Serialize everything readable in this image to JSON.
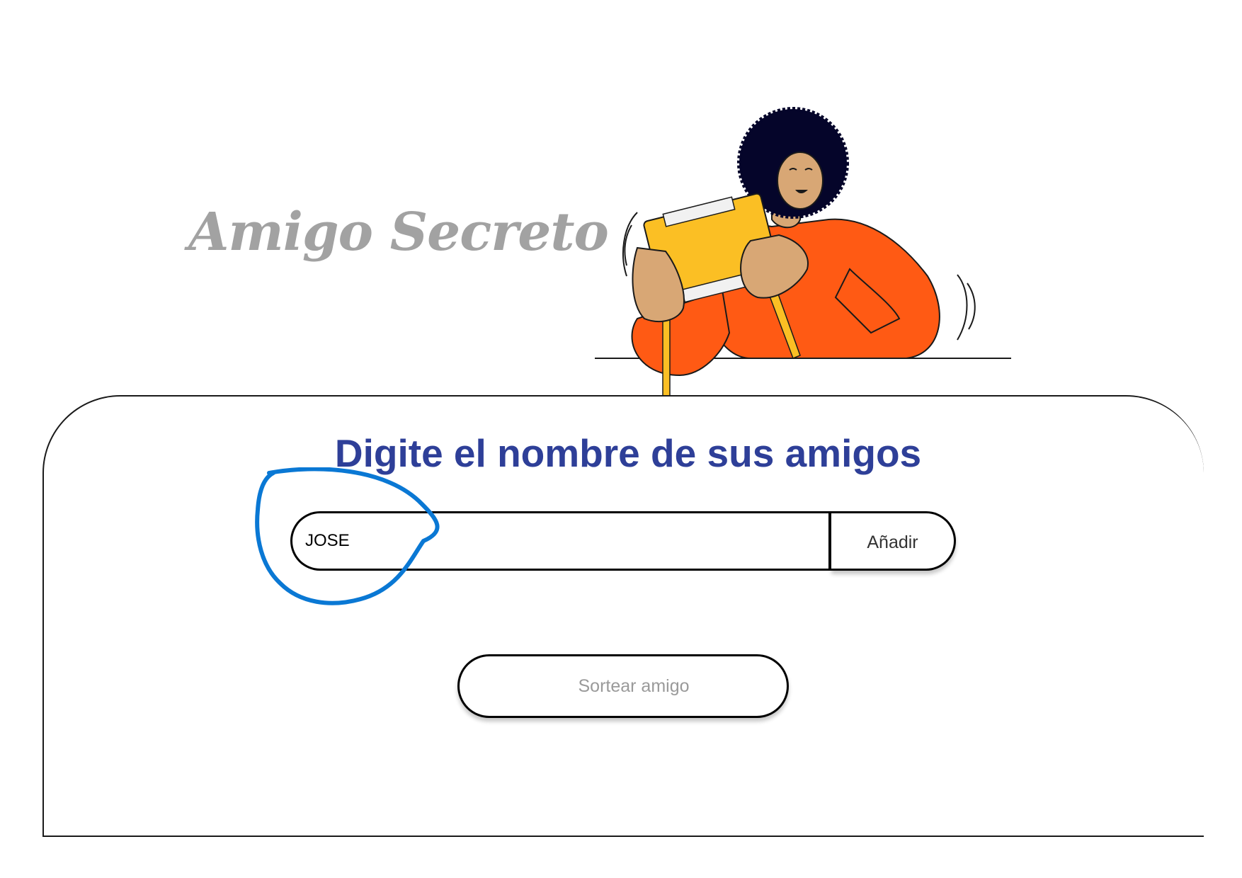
{
  "header": {
    "title": "Amigo Secreto"
  },
  "illustration": {
    "icon": "person-opening-gift-illustration"
  },
  "card": {
    "heading": "Digite el nombre de sus amigos",
    "name_input": {
      "value": "JOSE",
      "placeholder": ""
    },
    "add_button_label": "Añadir",
    "draw_button_label": "Sortear amigo"
  },
  "annotation": {
    "color": "#0a78d4",
    "icon": "hand-drawn-circle-annotation"
  },
  "colors": {
    "heading": "#2e3f98",
    "title": "#a2a2a2",
    "shirt": "#ff5a14",
    "gift": "#fbbf24",
    "skin": "#d8a775",
    "hair": "#05052a"
  }
}
